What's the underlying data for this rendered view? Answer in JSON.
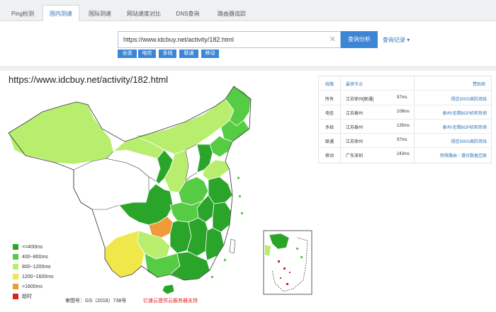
{
  "tabs": [
    {
      "label": "Ping检测",
      "active": false
    },
    {
      "label": "国内测速",
      "active": true
    },
    {
      "label": "国际测速",
      "active": false
    },
    {
      "label": "网站速度对比",
      "active": false
    },
    {
      "label": "DNS查询",
      "active": false
    },
    {
      "label": "路由器追踪",
      "active": false
    }
  ],
  "search": {
    "value": "https://www.idcbuy.net/activity/182.html",
    "button": "查询分析",
    "history": "查询记录 ▾"
  },
  "filters": [
    "全选",
    "电信",
    "多线",
    "联通",
    "移动"
  ],
  "map": {
    "title": "https://www.idcbuy.net/activity/182.html",
    "legend": [
      {
        "label": "<=400ms",
        "color": "#2aa52a"
      },
      {
        "label": "400~800ms",
        "color": "#55cc44"
      },
      {
        "label": "800~1200ms",
        "color": "#b7ee6e"
      },
      {
        "label": "1200~1600ms",
        "color": "#f0e84a"
      },
      {
        "label": ">1600ms",
        "color": "#f09a3a"
      },
      {
        "label": "超时",
        "color": "#dd1f1f"
      }
    ],
    "review_no": "审图号：GS（2018）738号",
    "sponsor": "亿速云提供云服务器支持"
  },
  "results": {
    "headers": {
      "line": "线路",
      "node": "最快节点",
      "sponsor": "赞助商"
    },
    "rows": [
      {
        "line": "所有",
        "node": "江苏徐州[联通]",
        "ms": "97ms",
        "sponsor": "视信300G高防双线"
      },
      {
        "line": "电信",
        "node": "江苏泰州",
        "ms": "108ms",
        "sponsor": "泰州/无锡BGP机柜热销"
      },
      {
        "line": "多线",
        "node": "江苏泰州",
        "ms": "135ms",
        "sponsor": "泰州/无锡BGP机柜热销"
      },
      {
        "line": "联通",
        "node": "江苏徐州",
        "ms": "97ms",
        "sponsor": "视信300G高防双线"
      },
      {
        "line": "移动",
        "node": "广东深圳",
        "ms": "243ms",
        "sponsor": "特殊路由｜遵台数据互联"
      }
    ]
  }
}
